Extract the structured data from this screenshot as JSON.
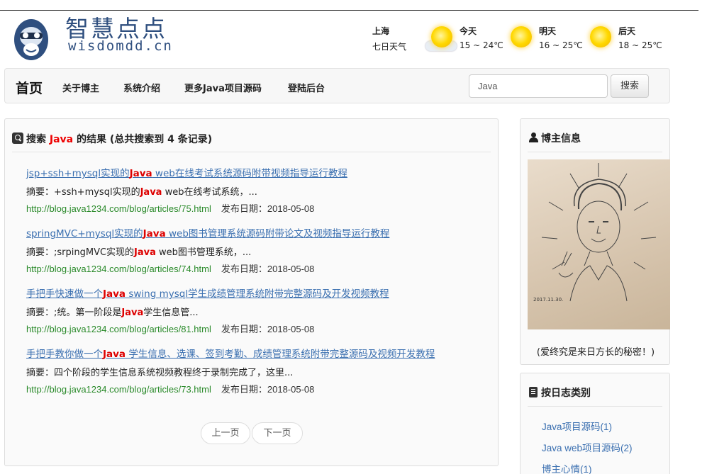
{
  "site": {
    "name_cn": "智慧点点",
    "name_en": "wisdomdd.cn"
  },
  "weather": {
    "city": "上海",
    "label": "七日天气",
    "days": [
      {
        "day": "今天",
        "temp": "15 ~ 24℃"
      },
      {
        "day": "明天",
        "temp": "16 ~ 25℃"
      },
      {
        "day": "后天",
        "temp": "18 ~ 25℃"
      }
    ]
  },
  "nav": {
    "home": "首页",
    "items": [
      "关于博主",
      "系统介绍",
      "更多Java项目源码",
      "登陆后台"
    ],
    "search_value": "Java",
    "search_button": "搜索"
  },
  "results": {
    "head_prefix": "搜索 ",
    "keyword": "Java",
    "head_suffix": " 的结果 (总共搜索到 4 条记录)",
    "items": [
      {
        "title_pre": "jsp+ssh+mysql实现的",
        "title_kw": "Java",
        "title_post": " web在线考试系统源码附带视频指导运行教程",
        "summary_pre": "摘要：+ssh+mysql实现的",
        "summary_kw": "Java",
        "summary_post": " web在线考试系统，...",
        "url": "http://blog.java1234.com/blog/articles/75.html",
        "date": "发布日期：2018-05-08"
      },
      {
        "title_pre": "springMVC+mysql实现的",
        "title_kw": "Java",
        "title_post": " web图书管理系统源码附带论文及视频指导运行教程",
        "summary_pre": "摘要：;srpingMVC实现的",
        "summary_kw": "Java",
        "summary_post": " web图书管理系统，...",
        "url": "http://blog.java1234.com/blog/articles/74.html",
        "date": "发布日期：2018-05-08"
      },
      {
        "title_pre": "手把手快速做一个",
        "title_kw": "Java",
        "title_post": " swing mysql学生成绩管理系统附带完整源码及开发视频教程",
        "summary_pre": "摘要：;统。第一阶段是",
        "summary_kw": "Java",
        "summary_post": "学生信息管...",
        "url": "http://blog.java1234.com/blog/articles/81.html",
        "date": "发布日期：2018-05-08"
      },
      {
        "title_pre": "手把手教你做一个",
        "title_kw": "Java",
        "title_post": " 学生信息、选课、签到考勤、成绩管理系统附带完整源码及视频开发教程",
        "summary_pre": "摘要：四个阶段的学生信息系统视频教程终于录制完成了，这里...",
        "summary_kw": "",
        "summary_post": "",
        "url": "http://blog.java1234.com/blog/articles/73.html",
        "date": "发布日期：2018-05-08"
      }
    ],
    "prev": "上一页",
    "next": "下一页"
  },
  "sidebar": {
    "blogger_title": "博主信息",
    "portrait_date": "2017.11.30.",
    "caption": "(爱终究是来日方长的秘密！)",
    "category_title": "按日志类别",
    "categories": [
      "Java项目源码(1)",
      "Java web项目源码(2)",
      "博主心情(1)"
    ]
  }
}
